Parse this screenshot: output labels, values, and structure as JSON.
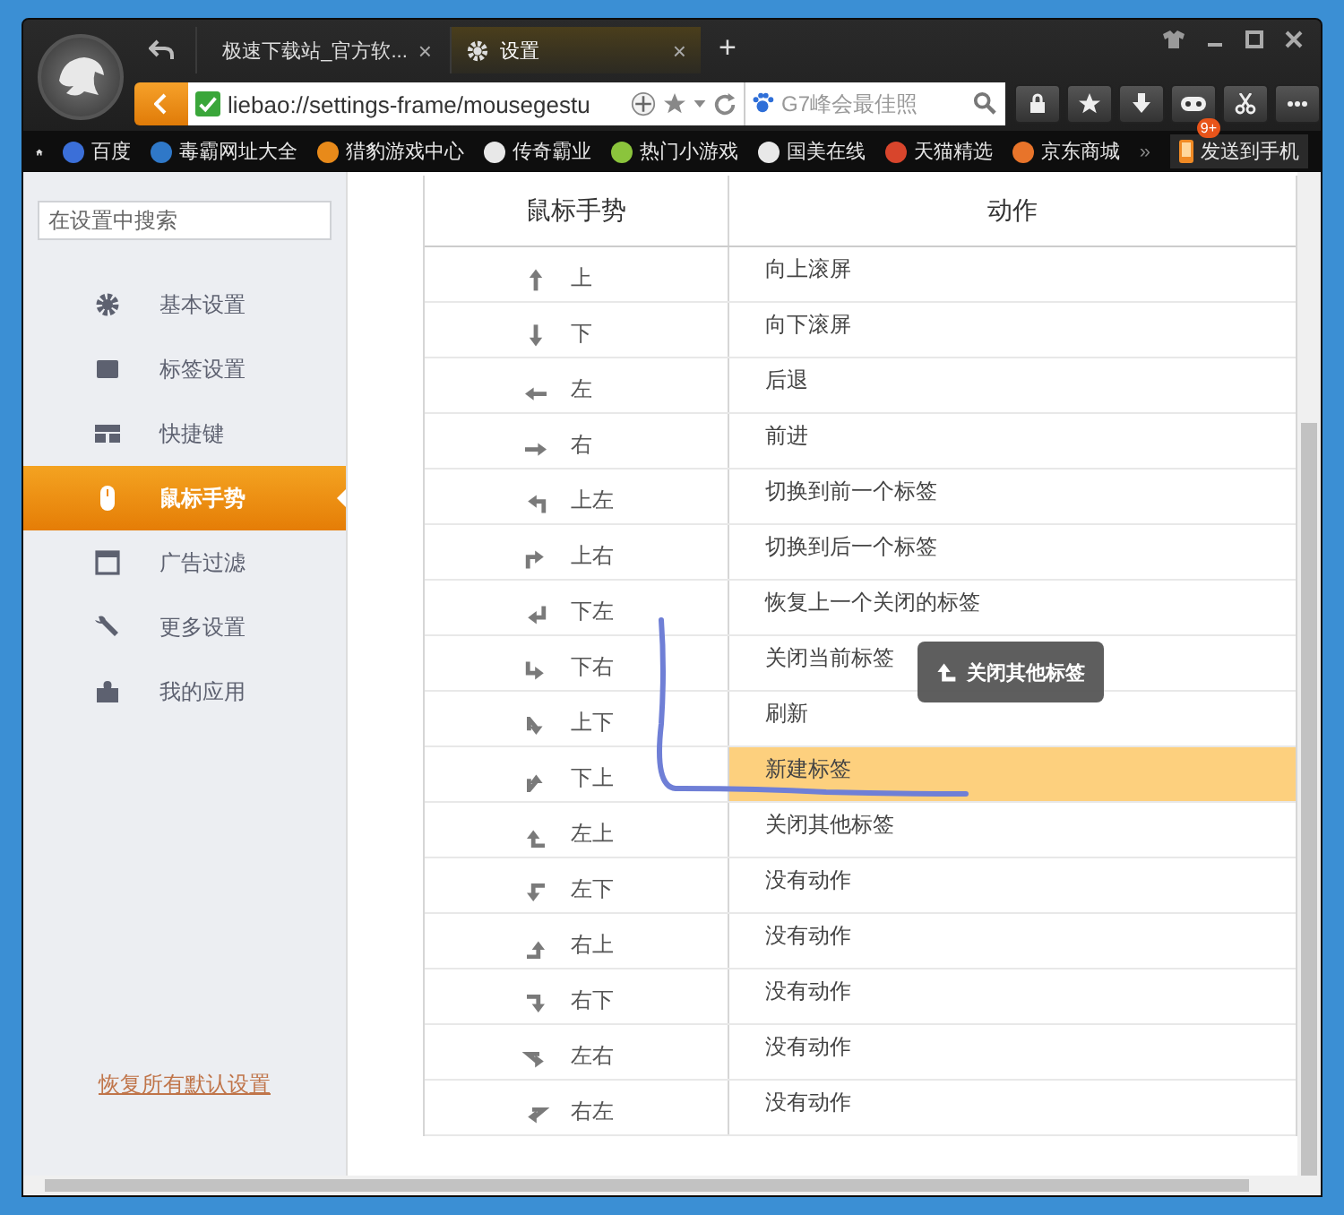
{
  "browser": {
    "tabs": [
      {
        "title": "极速下载站_官方软...",
        "selected": false,
        "close": "×"
      },
      {
        "title": "设置",
        "selected": true,
        "close": "×"
      }
    ],
    "new_tab": "+",
    "address": "liebao://settings-frame/mousegestu",
    "search_placeholder": "G7峰会最佳照",
    "badge": "9+",
    "bookmarks": [
      {
        "label": "百度",
        "color": "#3b6fd8"
      },
      {
        "label": "毒霸网址大全",
        "color": "#2f78c8"
      },
      {
        "label": "猎豹游戏中心",
        "color": "#e88a1a"
      },
      {
        "label": "传奇霸业",
        "color": "#e8e8e8"
      },
      {
        "label": "热门小游戏",
        "color": "#8bc43c"
      },
      {
        "label": "国美在线",
        "color": "#e8e8e8"
      },
      {
        "label": "天猫精选",
        "color": "#d8452c"
      },
      {
        "label": "京东商城",
        "color": "#e8742a"
      }
    ],
    "overflow": "»",
    "send_to_phone": "发送到手机"
  },
  "sidebar": {
    "search_placeholder": "在设置中搜索",
    "items": [
      {
        "label": "基本设置",
        "selected": false
      },
      {
        "label": "标签设置",
        "selected": false
      },
      {
        "label": "快捷键",
        "selected": false
      },
      {
        "label": "鼠标手势",
        "selected": true
      },
      {
        "label": "广告过滤",
        "selected": false
      },
      {
        "label": "更多设置",
        "selected": false
      },
      {
        "label": "我的应用",
        "selected": false
      }
    ],
    "restore_link": "恢复所有默认设置"
  },
  "table": {
    "columns": [
      "鼠标手势",
      "动作"
    ],
    "rows": [
      {
        "gesture": "上",
        "action": "向上滚屏",
        "selected": false
      },
      {
        "gesture": "下",
        "action": "向下滚屏",
        "selected": false
      },
      {
        "gesture": "左",
        "action": "后退",
        "selected": false
      },
      {
        "gesture": "右",
        "action": "前进",
        "selected": false
      },
      {
        "gesture": "上左",
        "action": "切换到前一个标签",
        "selected": false
      },
      {
        "gesture": "上右",
        "action": "切换到后一个标签",
        "selected": false
      },
      {
        "gesture": "下左",
        "action": "恢复上一个关闭的标签",
        "selected": false
      },
      {
        "gesture": "下右",
        "action": "关闭当前标签",
        "selected": false
      },
      {
        "gesture": "上下",
        "action": "刷新",
        "selected": false
      },
      {
        "gesture": "下上",
        "action": "新建标签",
        "selected": true
      },
      {
        "gesture": "左上",
        "action": "关闭其他标签",
        "selected": false
      },
      {
        "gesture": "左下",
        "action": "没有动作",
        "selected": false
      },
      {
        "gesture": "右上",
        "action": "没有动作",
        "selected": false
      },
      {
        "gesture": "右下",
        "action": "没有动作",
        "selected": false
      },
      {
        "gesture": "左右",
        "action": "没有动作",
        "selected": false
      },
      {
        "gesture": "右左",
        "action": "没有动作",
        "selected": false
      }
    ]
  },
  "tooltip": {
    "label": "关闭其他标签"
  }
}
